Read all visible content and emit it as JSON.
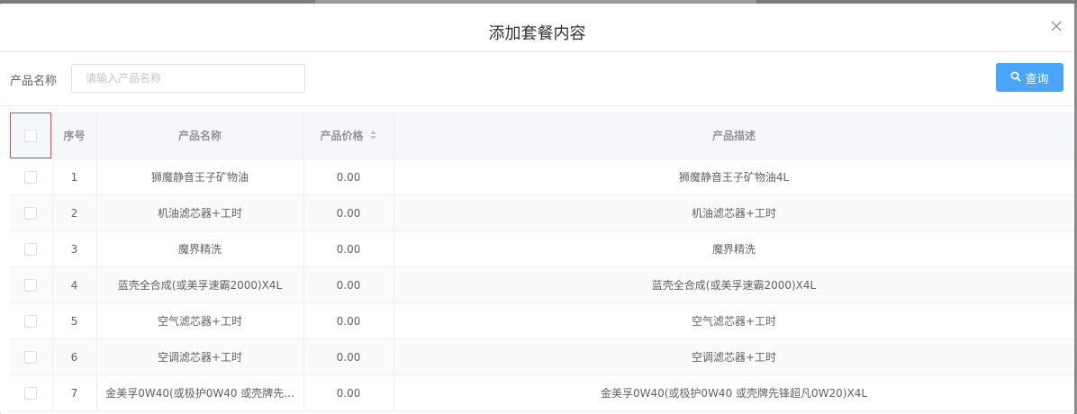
{
  "dialog": {
    "title": "添加套餐内容"
  },
  "search": {
    "label": "产品名称",
    "placeholder": "请输入产品名称",
    "value": "",
    "button_label": "查询"
  },
  "table": {
    "headers": {
      "index": "序号",
      "name": "产品名称",
      "price": "产品价格",
      "description": "产品描述"
    },
    "rows": [
      {
        "index": "1",
        "name": "狮魔静音王子矿物油",
        "price": "0.00",
        "description": "狮魔静音王子矿物油4L"
      },
      {
        "index": "2",
        "name": "机油滤芯器+工时",
        "price": "0.00",
        "description": "机油滤芯器+工时"
      },
      {
        "index": "3",
        "name": "魔界精洗",
        "price": "0.00",
        "description": "魔界精洗"
      },
      {
        "index": "4",
        "name": "蓝壳全合成(或美孚速霸2000)X4L",
        "price": "0.00",
        "description": "蓝壳全合成(或美孚速霸2000)X4L"
      },
      {
        "index": "5",
        "name": "空气滤芯器+工时",
        "price": "0.00",
        "description": "空气滤芯器+工时"
      },
      {
        "index": "6",
        "name": "空调滤芯器+工时",
        "price": "0.00",
        "description": "空调滤芯器+工时"
      },
      {
        "index": "7",
        "name": "金美孚0W40(或极护0W40 或壳牌先...",
        "price": "0.00",
        "description": "金美孚0W40(或极护0W40 或壳牌先锋超凡0W20)X4L"
      }
    ]
  },
  "colors": {
    "primary": "#4aa4f7",
    "highlight_border": "#e04848"
  }
}
